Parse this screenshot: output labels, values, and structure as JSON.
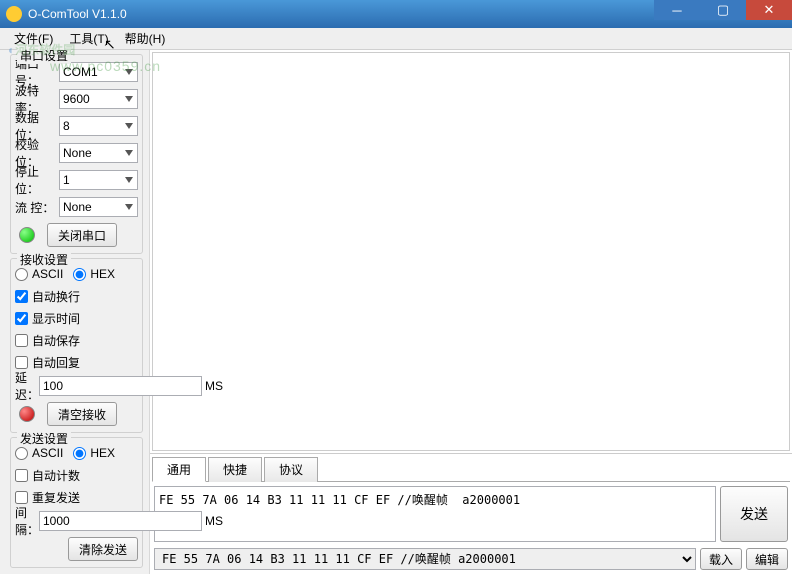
{
  "window": {
    "title": "O-ComTool V1.1.0"
  },
  "menubar": {
    "file": "文件(F)",
    "tools": "工具(T)",
    "help": "帮助(H)"
  },
  "watermark": {
    "brand": "河东软件园",
    "url": "www.pc0359.cn"
  },
  "port": {
    "group": "串口设置",
    "port_lbl": "端口号：",
    "port_val": "COM1",
    "baud_lbl": "波特率：",
    "baud_val": "9600",
    "data_lbl": "数据位：",
    "data_val": "8",
    "parity_lbl": "校验位：",
    "parity_val": "None",
    "stop_lbl": "停止位：",
    "stop_val": "1",
    "flow_lbl": "流  控：",
    "flow_val": "None",
    "close_btn": "关闭串口"
  },
  "rx": {
    "group": "接收设置",
    "ascii": "ASCII",
    "hex": "HEX",
    "autowrap": "自动换行",
    "showtime": "显示时间",
    "autosave": "自动保存",
    "autoreply": "自动回复",
    "delay_lbl": "延迟：",
    "delay_val": "100",
    "delay_unit": "MS",
    "clear_btn": "清空接收"
  },
  "tx": {
    "group": "发送设置",
    "ascii": "ASCII",
    "hex": "HEX",
    "autocount": "自动计数",
    "repeat": "重复发送",
    "interval_lbl": "间隔：",
    "interval_val": "1000",
    "interval_unit": "MS",
    "clear_btn": "清除发送"
  },
  "tabs": {
    "general": "通用",
    "quick": "快捷",
    "protocol": "协议"
  },
  "send": {
    "text": "FE 55 7A 06 14 B3 11 11 11 CF EF //唤醒帧  a2000001",
    "btn": "发送"
  },
  "history": {
    "text": "FE 55 7A 06 14 B3 11 11 11 CF EF //唤醒帧   a2000001",
    "load_btn": "载入",
    "edit_btn": "编辑"
  }
}
